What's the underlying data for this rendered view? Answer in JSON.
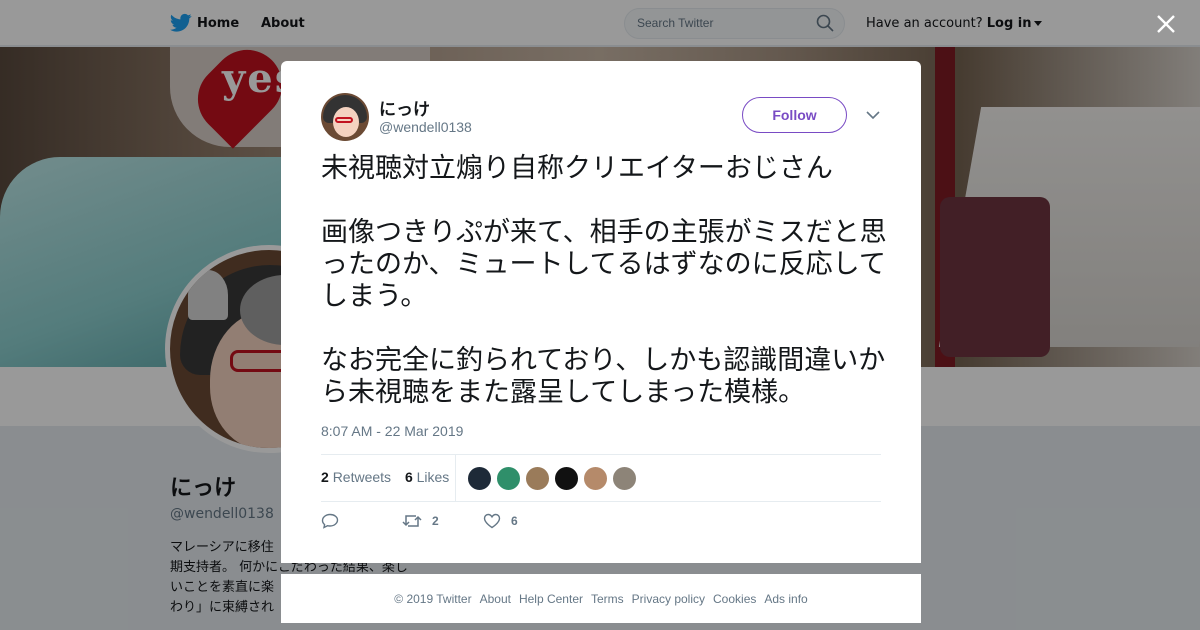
{
  "topbar": {
    "home_label": "Home",
    "about_label": "About",
    "search_placeholder": "Search Twitter",
    "account_prompt": "Have an account?",
    "login_label": "Log in"
  },
  "profile": {
    "name": "にっけ",
    "handle": "@wendell0138",
    "bio_lines": [
      "マレーシアに移住",
      "期支持者。 何かにこだわった結果、楽し",
      "いことを素直に楽",
      "わり」に束縛され"
    ]
  },
  "tweet": {
    "author_name": "にっけ",
    "author_handle": "@wendell0138",
    "follow_label": "Follow",
    "paragraphs": [
      "未視聴対立煽り自称クリエイターおじさん",
      "画像つきりぷが来て、相手の主張がミスだと思ったのか、ミュートしてるはずなのに反応してしまう。",
      "なお完全に釣られており、しかも認識間違いから未視聴をまた露呈してしまった模様。"
    ],
    "timestamp": "8:07 AM - 22 Mar 2019",
    "retweets_count": "2",
    "retweets_label": "Retweets",
    "likes_count": "6",
    "likes_label": "Likes",
    "action_retweet_count": "2",
    "action_like_count": "6"
  },
  "liker_avatars": [
    {
      "name": "liker-1",
      "color": "#1e2a38"
    },
    {
      "name": "liker-2",
      "color": "#2f8f6a"
    },
    {
      "name": "liker-3",
      "color": "#9a7b5a"
    },
    {
      "name": "liker-4",
      "color": "#111111"
    },
    {
      "name": "liker-5",
      "color": "#b58a6a"
    },
    {
      "name": "liker-6",
      "color": "#8d8478"
    }
  ],
  "footer": {
    "links": [
      "© 2019 Twitter",
      "About",
      "Help Center",
      "Terms",
      "Privacy policy",
      "Cookies",
      "Ads info"
    ]
  },
  "colors": {
    "accent_purple": "#794bc4",
    "twitter_blue": "#1da1f2",
    "text_primary": "#14171a",
    "text_secondary": "#657786"
  },
  "icons": {
    "logo": "twitter-bird-icon",
    "search": "search-icon",
    "close": "close-icon",
    "dropdown": "chevron-down-icon",
    "reply": "reply-icon",
    "retweet": "retweet-icon",
    "like": "heart-icon"
  }
}
